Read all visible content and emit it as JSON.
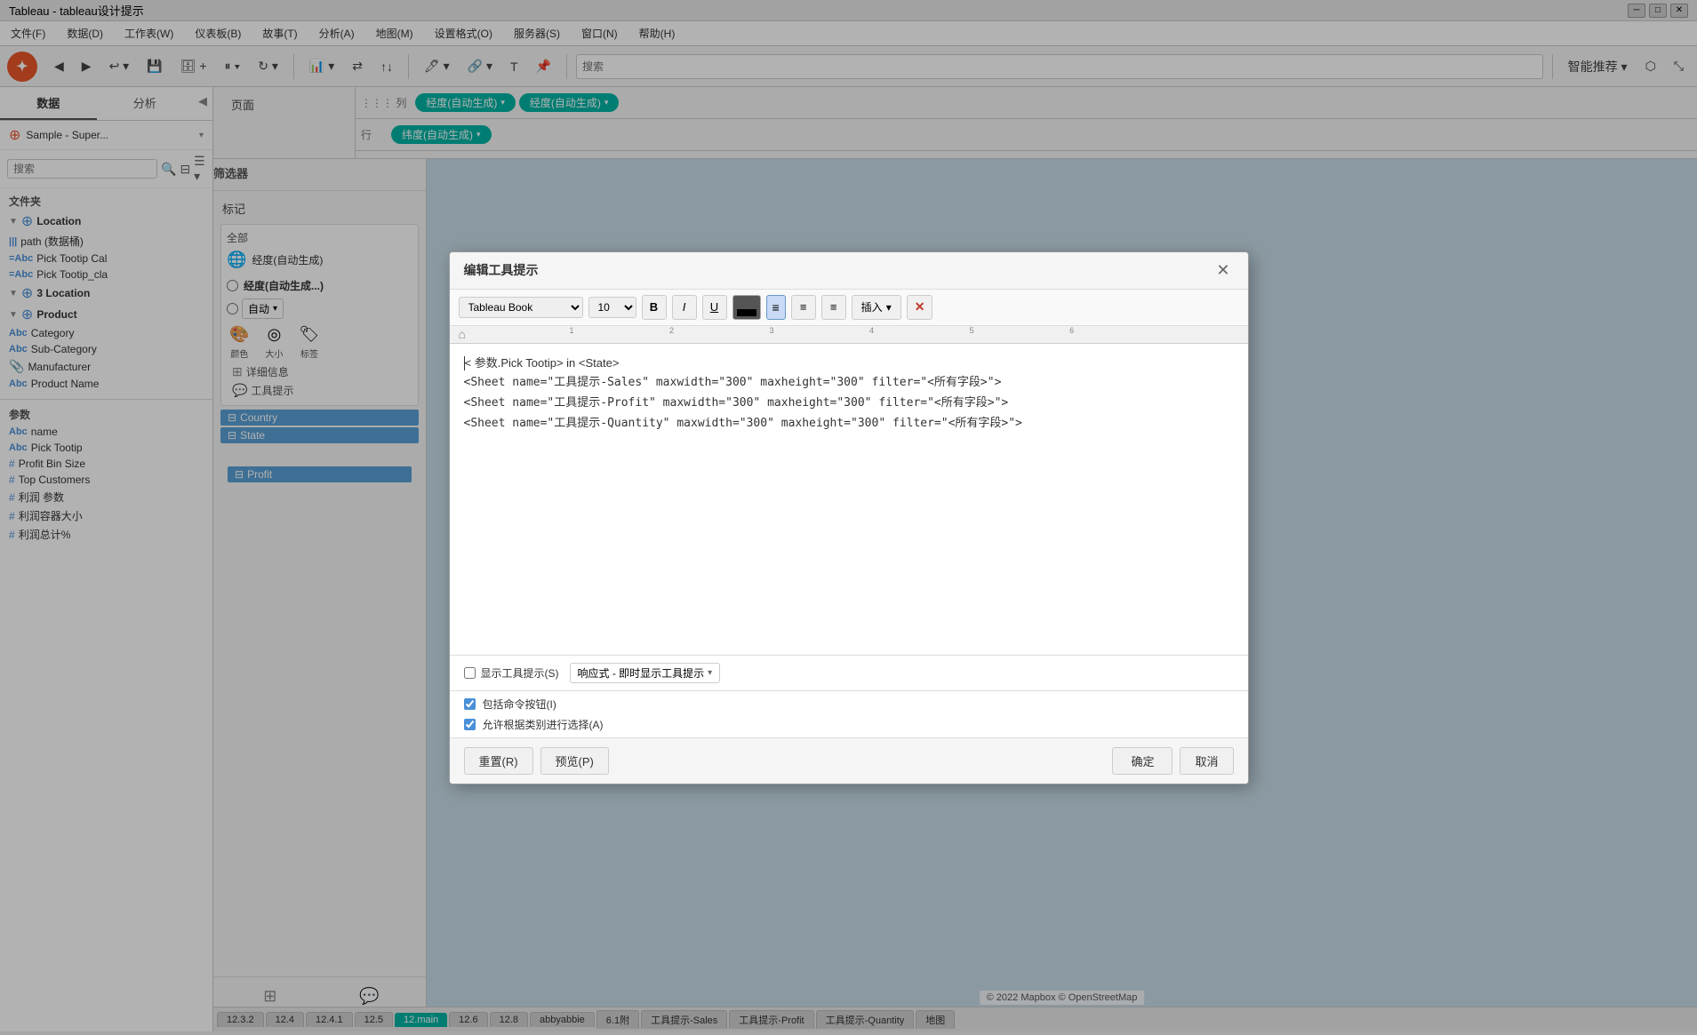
{
  "window": {
    "title": "Tableau - tableau设计提示"
  },
  "menu": {
    "items": [
      "文件(F)",
      "数据(D)",
      "工作表(W)",
      "仪表板(B)",
      "故事(T)",
      "分析(A)",
      "地图(M)",
      "设置格式(O)",
      "服务器(S)",
      "窗口(N)",
      "帮助(H)"
    ]
  },
  "left_panel": {
    "tabs": [
      "数据",
      "分析"
    ],
    "datasource": "Sample - Super...",
    "search_placeholder": "搜索",
    "section_folder": "文件夹",
    "items_dimensions": [
      {
        "icon": "geo",
        "label": "Location",
        "indent": 0,
        "expanded": true
      },
      {
        "icon": "path",
        "label": "path (数据桶)",
        "indent": 0
      },
      {
        "icon": "abc",
        "label": "Pick Tootip Cal",
        "indent": 0
      },
      {
        "icon": "abc",
        "label": "Pick Tootip_cla",
        "indent": 0
      },
      {
        "icon": "geo",
        "label": "Product",
        "indent": 0,
        "expanded": true
      },
      {
        "icon": "abc",
        "label": "Category",
        "indent": 1
      },
      {
        "icon": "abc",
        "label": "Sub-Category",
        "indent": 1
      },
      {
        "icon": "clip",
        "label": "Manufacturer",
        "indent": 1
      },
      {
        "icon": "abc",
        "label": "Product Name",
        "indent": 1
      }
    ],
    "section_params": "参数",
    "params": [
      {
        "icon": "abc",
        "label": "name"
      },
      {
        "icon": "abc",
        "label": "Pick Tootip"
      },
      {
        "icon": "hash",
        "label": "Profit Bin Size"
      },
      {
        "icon": "hash",
        "label": "Top Customers"
      },
      {
        "icon": "hash",
        "label": "利润 参数"
      },
      {
        "icon": "hash",
        "label": "利润容器大小"
      },
      {
        "icon": "hash",
        "label": "利润总计%"
      }
    ]
  },
  "pages_section": {
    "title": "页面"
  },
  "filter_section": {
    "title": "筛选器"
  },
  "marks_section": {
    "title": "标记",
    "all_label": "全部",
    "type": "经度(自动生成)",
    "type2": "经度(自动生成...)",
    "auto_label": "自动",
    "buttons": [
      "颜色",
      "大小",
      "标签",
      "详细信息",
      "工具提示"
    ],
    "items": [
      {
        "icon": "teal-dot",
        "label": "Country",
        "bg": "teal"
      },
      {
        "icon": "teal-dot",
        "label": "State",
        "bg": "teal"
      }
    ]
  },
  "canvas": {
    "col_shelf_label": "列",
    "row_shelf_label": "行",
    "col_pills": [
      "经度(自动生成)",
      "经度(自动生成)"
    ],
    "row_pills": [
      "纬度(自动生成)"
    ]
  },
  "bottom_tabs": {
    "items": [
      "12.3.2",
      "12.4",
      "12.4.1",
      "12.5",
      "12.main",
      "12.6",
      "12.8",
      "abbyabbie",
      "6.1附",
      "工具提示-Sales",
      "工具提示-Profit",
      "工具提示-Quantity",
      "地图"
    ]
  },
  "map": {
    "copyright": "© 2022 Mapbox © OpenStreetMap"
  },
  "modal": {
    "title": "编辑工具提示",
    "font": "Tableau Book",
    "size": "10",
    "buttons_fmt": [
      "B",
      "I",
      "U"
    ],
    "color_label": "Color",
    "align_buttons": [
      "left",
      "center",
      "right"
    ],
    "insert_label": "插入",
    "clear_label": "✕",
    "content_lines": [
      "< 参数.Pick Tootip> in <State>",
      "<Sheet name=\"工具提示-Sales\" maxwidth=\"300\" maxheight=\"300\" filter=\"<所有字段>\">",
      "<Sheet name=\"工具提示-Profit\" maxwidth=\"300\" maxheight=\"300\" filter=\"<所有字段>\">",
      "<Sheet name=\"工具提示-Quantity\" maxwidth=\"300\" maxheight=\"300\" filter=\"<所有字段>\">"
    ],
    "show_tooltip_label": "显示工具提示(S)",
    "tooltip_mode": "响应式 - 即时显示工具提示",
    "include_commands_label": "包括命令按钮(I)",
    "include_commands_checked": true,
    "allow_select_label": "允许根据类别进行选择(A)",
    "allow_select_checked": true,
    "btn_reset": "重置(R)",
    "btn_preview": "预览(P)",
    "btn_ok": "确定",
    "btn_cancel": "取消"
  }
}
